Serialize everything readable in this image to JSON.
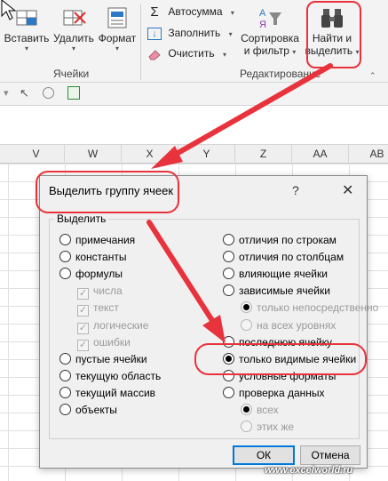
{
  "ribbon": {
    "cells_group": {
      "label": "Ячейки",
      "insert_label": "Вставить",
      "delete_label": "Удалить",
      "format_label": "Формат"
    },
    "editing_group": {
      "label": "Редактирование",
      "autosum_label": "Автосумма",
      "fill_label": "Заполнить",
      "clear_label": "Очистить",
      "sort_line1": "Сортировка",
      "sort_line2": "и фильтр",
      "find_line1": "Найти и",
      "find_line2": "выделить"
    }
  },
  "columns": [
    "V",
    "W",
    "X",
    "Y",
    "Z",
    "AA",
    "AB"
  ],
  "dialog": {
    "title": "Выделить группу ячеек",
    "help": "?",
    "close": "✕",
    "legend": "Выделить",
    "left_options": [
      {
        "label": "примечания",
        "type": "radio",
        "selected": false,
        "disabled": false
      },
      {
        "label": "константы",
        "type": "radio",
        "selected": false,
        "disabled": false
      },
      {
        "label": "формулы",
        "type": "radio",
        "selected": false,
        "disabled": false
      },
      {
        "label": "числа",
        "type": "checkbox",
        "checked": true,
        "disabled": true
      },
      {
        "label": "текст",
        "type": "checkbox",
        "checked": true,
        "disabled": true
      },
      {
        "label": "логические",
        "type": "checkbox",
        "checked": true,
        "disabled": true
      },
      {
        "label": "ошибки",
        "type": "checkbox",
        "checked": true,
        "disabled": true
      },
      {
        "label": "пустые ячейки",
        "type": "radio",
        "selected": false,
        "disabled": false
      },
      {
        "label": "текущую область",
        "type": "radio",
        "selected": false,
        "disabled": false
      },
      {
        "label": "текущий массив",
        "type": "radio",
        "selected": false,
        "disabled": false
      },
      {
        "label": "объекты",
        "type": "radio",
        "selected": false,
        "disabled": false
      }
    ],
    "right_options": [
      {
        "label": "отличия по строкам",
        "type": "radio",
        "selected": false,
        "disabled": false
      },
      {
        "label": "отличия по столбцам",
        "type": "radio",
        "selected": false,
        "disabled": false
      },
      {
        "label": "влияющие ячейки",
        "type": "radio",
        "selected": false,
        "disabled": false
      },
      {
        "label": "зависимые ячейки",
        "type": "radio",
        "selected": false,
        "disabled": false
      },
      {
        "label": "только непосредственно",
        "type": "radio",
        "selected": true,
        "disabled": true
      },
      {
        "label": "на всех уровнях",
        "type": "radio",
        "selected": false,
        "disabled": true
      },
      {
        "label": "последнюю ячейку",
        "type": "radio",
        "selected": false,
        "disabled": false
      },
      {
        "label": "только видимые ячейки",
        "type": "radio",
        "selected": true,
        "disabled": false
      },
      {
        "label": "условные форматы",
        "type": "radio",
        "selected": false,
        "disabled": false
      },
      {
        "label": "проверка данных",
        "type": "radio",
        "selected": false,
        "disabled": false
      },
      {
        "label": "всех",
        "type": "radio",
        "selected": true,
        "disabled": true
      },
      {
        "label": "этих же",
        "type": "radio",
        "selected": false,
        "disabled": true
      }
    ],
    "ok_label": "ОК",
    "cancel_label": "Отмена"
  },
  "watermark": "www.excelworld.ru",
  "colors": {
    "annotation": "#e8323c",
    "accent": "#0078d7"
  }
}
